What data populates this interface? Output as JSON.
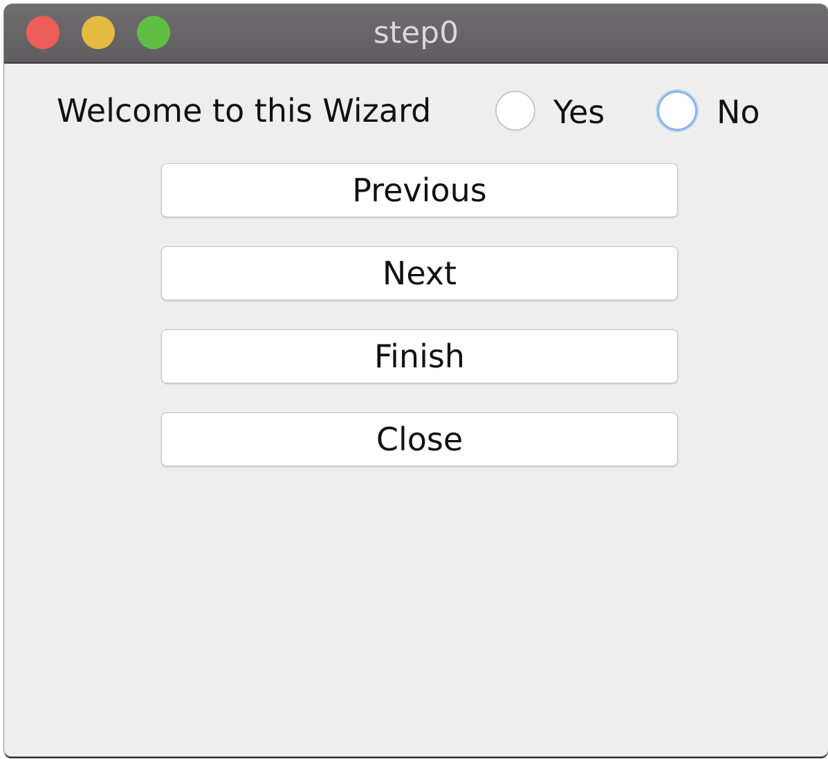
{
  "window": {
    "title": "step0",
    "controls": {
      "close_icon": "traffic-light-close",
      "minimize_icon": "traffic-light-minimize",
      "zoom_icon": "traffic-light-zoom",
      "close_color": "#ec5e57",
      "minimize_color": "#e3bb40",
      "zoom_color": "#5fbf45"
    }
  },
  "content": {
    "welcome_text": "Welcome to this Wizard",
    "radio_group": {
      "options": [
        {
          "label": "Yes",
          "selected": false,
          "focused": false
        },
        {
          "label": "No",
          "selected": false,
          "focused": true
        }
      ],
      "focus_color": "#87b5ea"
    },
    "buttons": {
      "previous": "Previous",
      "next": "Next",
      "finish": "Finish",
      "close": "Close"
    }
  }
}
